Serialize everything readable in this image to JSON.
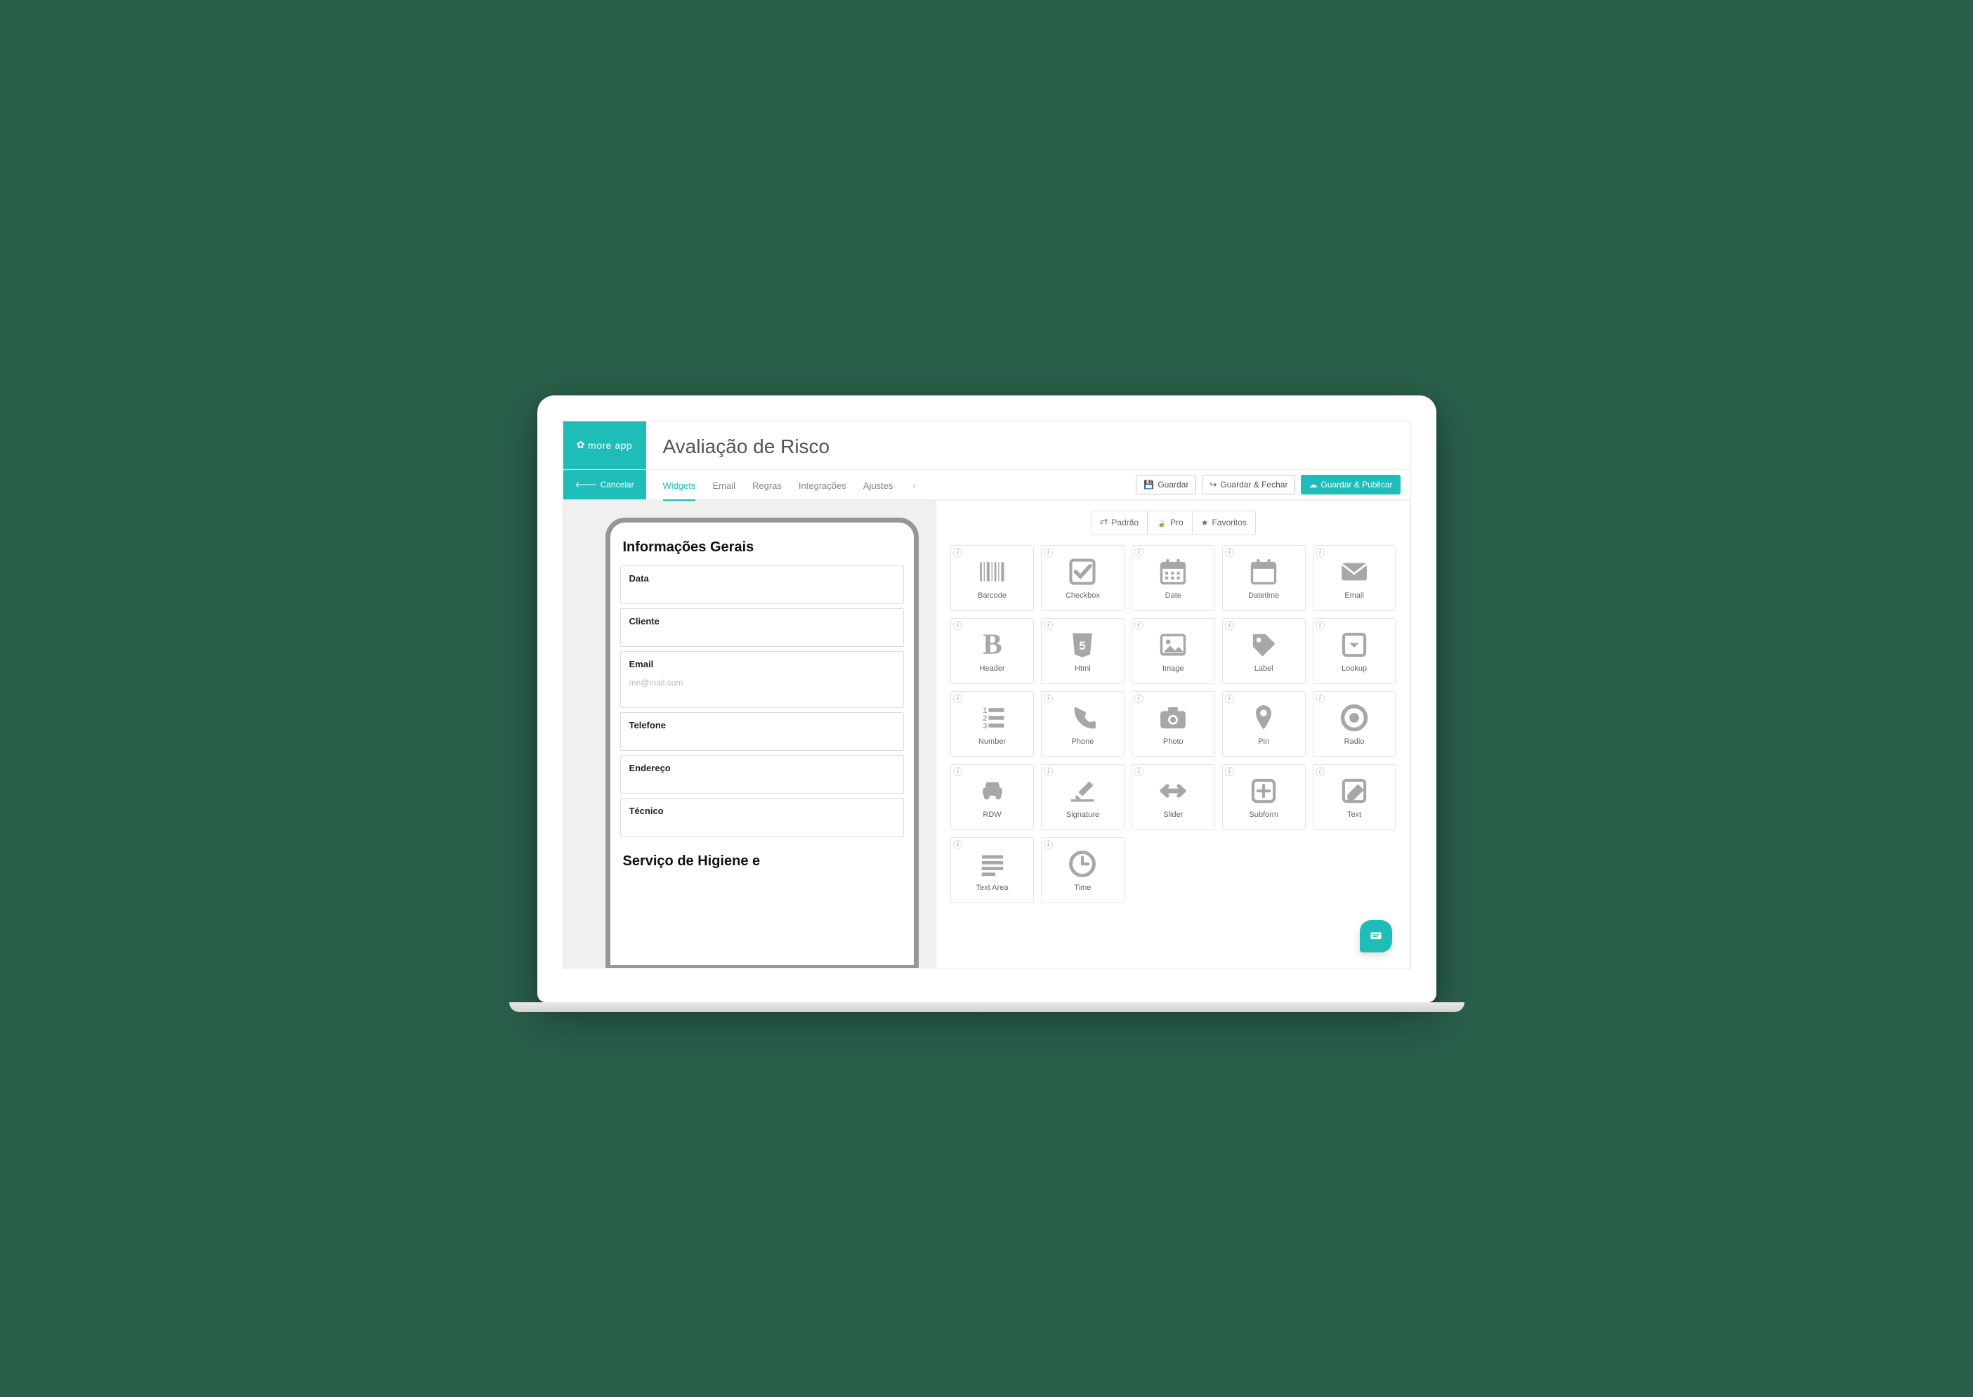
{
  "brand": {
    "name": "more app"
  },
  "page_title": "Avaliação de Risco",
  "cancel_label": "Cancelar",
  "tabs": [
    {
      "id": "widgets",
      "label": "Widgets",
      "active": true
    },
    {
      "id": "email",
      "label": "Email"
    },
    {
      "id": "regras",
      "label": "Regras"
    },
    {
      "id": "integracoes",
      "label": "Integrações"
    },
    {
      "id": "ajustes",
      "label": "Ajustes"
    }
  ],
  "actions": {
    "save": "Guardar",
    "save_close": "Guardar & Fechar",
    "save_publish": "Guardar & Publicar"
  },
  "preview": {
    "section1_title": "Informações Gerais",
    "fields": [
      {
        "label": "Data",
        "placeholder": ""
      },
      {
        "label": "Cliente",
        "placeholder": ""
      },
      {
        "label": "Email",
        "placeholder": "me@mail.com"
      },
      {
        "label": "Telefone",
        "placeholder": ""
      },
      {
        "label": "Endereço",
        "placeholder": ""
      },
      {
        "label": "Técnico",
        "placeholder": ""
      }
    ],
    "section2_title": "Serviço de Higiene e"
  },
  "filters": {
    "padrao": "Padrão",
    "pro": "Pro",
    "favoritos": "Favoritos"
  },
  "widgets": [
    {
      "id": "barcode",
      "label": "Barcode"
    },
    {
      "id": "checkbox",
      "label": "Checkbox"
    },
    {
      "id": "date",
      "label": "Date"
    },
    {
      "id": "datetime",
      "label": "Datetime"
    },
    {
      "id": "email",
      "label": "Email"
    },
    {
      "id": "header",
      "label": "Header"
    },
    {
      "id": "html",
      "label": "Html"
    },
    {
      "id": "image",
      "label": "Image"
    },
    {
      "id": "label",
      "label": "Label"
    },
    {
      "id": "lookup",
      "label": "Lookup"
    },
    {
      "id": "number",
      "label": "Number"
    },
    {
      "id": "phone",
      "label": "Phone"
    },
    {
      "id": "photo",
      "label": "Photo"
    },
    {
      "id": "pin",
      "label": "Pin"
    },
    {
      "id": "radio",
      "label": "Radio"
    },
    {
      "id": "rdw",
      "label": "RDW"
    },
    {
      "id": "signature",
      "label": "Signature"
    },
    {
      "id": "slider",
      "label": "Slider"
    },
    {
      "id": "subform",
      "label": "Subform"
    },
    {
      "id": "text",
      "label": "Text"
    },
    {
      "id": "textarea",
      "label": "Text Area"
    },
    {
      "id": "time",
      "label": "Time"
    }
  ]
}
